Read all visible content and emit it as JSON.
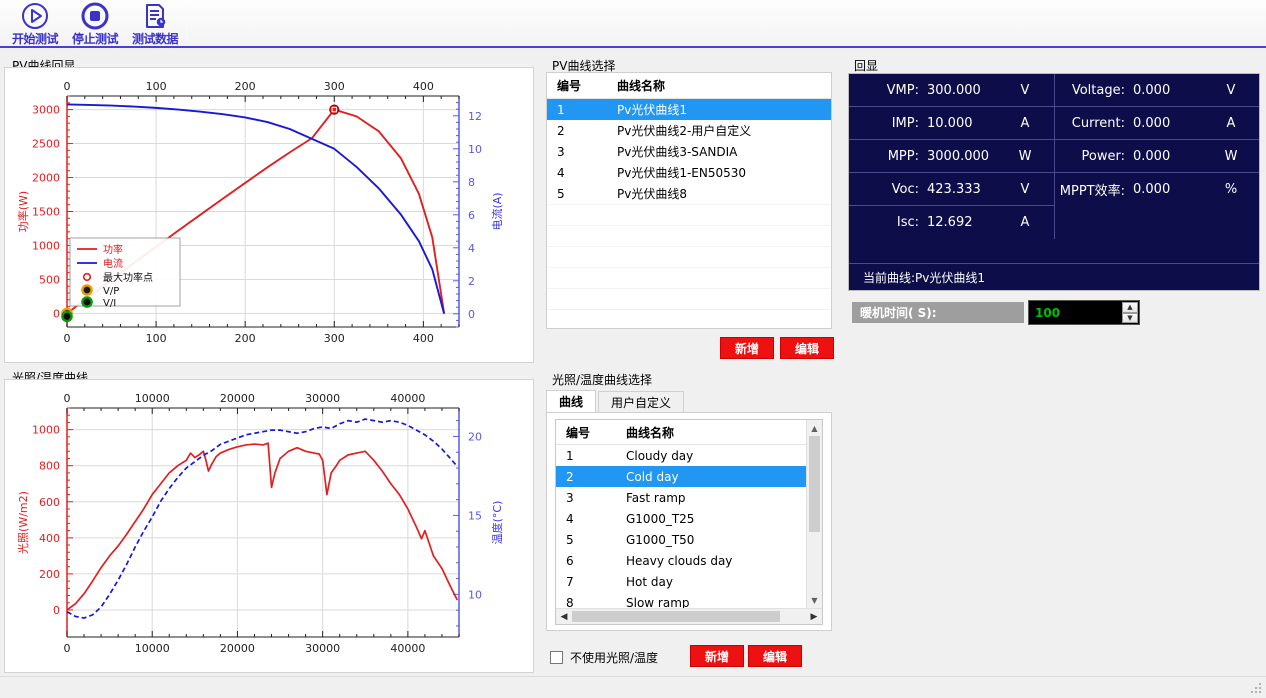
{
  "toolbar": {
    "buttons": [
      {
        "label": "开始测试",
        "icon": "play-circle-icon"
      },
      {
        "label": "停止测试",
        "icon": "stop-circle-icon"
      },
      {
        "label": "测试数据",
        "icon": "document-clock-icon"
      }
    ]
  },
  "pv_chart_group": {
    "title": "PV曲线回显"
  },
  "irr_chart_group": {
    "title": "光照/温度曲线"
  },
  "pv_select": {
    "title": "PV曲线选择",
    "columns": [
      "编号",
      "曲线名称"
    ],
    "rows": [
      {
        "id": "1",
        "name": "Pv光伏曲线1",
        "selected": true
      },
      {
        "id": "2",
        "name": "Pv光伏曲线2-用户自定义",
        "selected": false
      },
      {
        "id": "3",
        "name": "Pv光伏曲线3-SANDIA",
        "selected": false
      },
      {
        "id": "4",
        "name": "Pv光伏曲线1-EN50530",
        "selected": false
      },
      {
        "id": "5",
        "name": "Pv光伏曲线8",
        "selected": false
      }
    ],
    "add_label": "新增",
    "edit_label": "编辑"
  },
  "irr_select": {
    "title": "光照/温度曲线选择",
    "tabs": [
      {
        "label": "曲线",
        "active": true
      },
      {
        "label": "用户自定义",
        "active": false
      }
    ],
    "columns": [
      "编号",
      "曲线名称"
    ],
    "rows": [
      {
        "id": "1",
        "name": "Cloudy day",
        "selected": false
      },
      {
        "id": "2",
        "name": "Cold day",
        "selected": true
      },
      {
        "id": "3",
        "name": "Fast ramp",
        "selected": false
      },
      {
        "id": "4",
        "name": "G1000_T25",
        "selected": false
      },
      {
        "id": "5",
        "name": "G1000_T50",
        "selected": false
      },
      {
        "id": "6",
        "name": "Heavy clouds day",
        "selected": false
      },
      {
        "id": "7",
        "name": "Hot day",
        "selected": false
      },
      {
        "id": "8",
        "name": "Slow ramp",
        "selected": false
      }
    ],
    "checkbox_label": "不使用光照/温度",
    "checkbox_checked": false,
    "add_label": "新增",
    "edit_label": "编辑"
  },
  "readout": {
    "title": "回显",
    "left": [
      {
        "key": "VMP:",
        "value": "300.000",
        "unit": "V"
      },
      {
        "key": "IMP:",
        "value": "10.000",
        "unit": "A"
      },
      {
        "key": "MPP:",
        "value": "3000.000",
        "unit": "W"
      },
      {
        "key": "Voc:",
        "value": "423.333",
        "unit": "V"
      },
      {
        "key": "Isc:",
        "value": "12.692",
        "unit": "A"
      }
    ],
    "right": [
      {
        "key": "Voltage:",
        "value": "0.000",
        "unit": "V"
      },
      {
        "key": "Current:",
        "value": "0.000",
        "unit": "A"
      },
      {
        "key": "Power:",
        "value": "0.000",
        "unit": "W"
      },
      {
        "key": "MPPT效率:",
        "value": "0.000",
        "unit": "%"
      }
    ],
    "footer": "当前曲线:Pv光伏曲线1",
    "bg_color": "#0d0d4a"
  },
  "warmup": {
    "label": "暖机时间( S):",
    "value": "100"
  },
  "colors": {
    "accent_blue": "#4a3fd0",
    "power_red": "#e02020",
    "current_blue": "#1818d8",
    "select_blue": "#2196f3",
    "button_red": "#ee1111"
  },
  "chart_data": [
    {
      "type": "line",
      "title": "PV曲线回显",
      "xlabel": "",
      "ylabel": "功率(W)",
      "y2label": "电流(A)",
      "xlim": [
        0,
        440
      ],
      "ylim": [
        -200,
        3200
      ],
      "y2lim": [
        -0.8,
        13.2
      ],
      "xticks": [
        0,
        100,
        200,
        300,
        400
      ],
      "yticks": [
        0,
        500,
        1000,
        1500,
        2000,
        2500,
        3000
      ],
      "y2ticks": [
        0,
        2,
        4,
        6,
        8,
        10,
        12
      ],
      "grid": true,
      "legend_position": "lower-left",
      "legend": [
        "功率",
        "电流",
        "最大功率点",
        "V/P",
        "V/I"
      ],
      "annotations": [
        {
          "label": "最大功率点",
          "x": 300,
          "y": 3000
        }
      ],
      "series": [
        {
          "name": "功率",
          "color": "#e02020",
          "axis": "left",
          "x": [
            0,
            25,
            50,
            75,
            100,
            125,
            150,
            175,
            200,
            225,
            250,
            275,
            300,
            325,
            350,
            375,
            395,
            410,
            423.3
          ],
          "y": [
            0,
            248,
            495,
            740,
            980,
            1220,
            1455,
            1690,
            1920,
            2150,
            2370,
            2580,
            3000,
            2900,
            2680,
            2280,
            1760,
            1120,
            0
          ]
        },
        {
          "name": "电流",
          "color": "#1818d8",
          "axis": "right",
          "x": [
            0,
            25,
            50,
            75,
            100,
            125,
            150,
            175,
            200,
            225,
            250,
            275,
            300,
            325,
            350,
            375,
            395,
            410,
            423.3
          ],
          "y": [
            12.69,
            12.66,
            12.62,
            12.56,
            12.48,
            12.38,
            12.25,
            12.1,
            11.9,
            11.62,
            11.2,
            10.6,
            10.0,
            8.9,
            7.6,
            6.0,
            4.4,
            2.7,
            0
          ]
        }
      ]
    },
    {
      "type": "line",
      "title": "光照/温度曲线",
      "xlabel": "",
      "ylabel": "光照(W/m2)",
      "y2label": "温度(°C)",
      "xlim": [
        0,
        46000
      ],
      "ylim": [
        -150,
        1120
      ],
      "y2lim": [
        7.3,
        21.8
      ],
      "xticks": [
        0,
        10000,
        20000,
        30000,
        40000
      ],
      "yticks": [
        0,
        200,
        400,
        600,
        800,
        1000
      ],
      "y2ticks": [
        10,
        15,
        20
      ],
      "grid": true,
      "series": [
        {
          "name": "光照",
          "color": "#e02020",
          "axis": "left",
          "x": [
            0,
            1000,
            2000,
            3000,
            4000,
            5000,
            6000,
            7000,
            8000,
            9000,
            10000,
            11000,
            12000,
            13000,
            14000,
            14500,
            15000,
            15500,
            16000,
            16300,
            16600,
            17000,
            17500,
            18000,
            19000,
            20000,
            21000,
            22000,
            23000,
            23600,
            24000,
            24400,
            25000,
            26000,
            27000,
            28000,
            29000,
            29600,
            30000,
            30500,
            31000,
            31600,
            32000,
            33000,
            34000,
            35000,
            36000,
            37000,
            38000,
            39000,
            40000,
            41000,
            41600,
            42000,
            43000,
            44000,
            45000,
            45800
          ],
          "y": [
            0,
            35,
            90,
            160,
            235,
            300,
            355,
            420,
            490,
            560,
            640,
            700,
            760,
            800,
            830,
            870,
            845,
            860,
            880,
            830,
            770,
            810,
            850,
            870,
            890,
            905,
            915,
            920,
            915,
            925,
            680,
            760,
            840,
            880,
            900,
            880,
            870,
            865,
            830,
            640,
            760,
            800,
            830,
            860,
            870,
            880,
            830,
            770,
            700,
            640,
            560,
            460,
            395,
            440,
            300,
            230,
            130,
            55
          ]
        },
        {
          "name": "温度",
          "color": "#1818d8",
          "axis": "right",
          "x": [
            0,
            1000,
            2000,
            3000,
            4000,
            5000,
            6000,
            7000,
            8000,
            9000,
            10000,
            11000,
            12000,
            13000,
            14000,
            15000,
            16000,
            17000,
            18000,
            19000,
            20000,
            21000,
            22000,
            23000,
            24000,
            25000,
            26000,
            27000,
            28000,
            29000,
            30000,
            31000,
            32000,
            33000,
            34000,
            35000,
            36000,
            37000,
            38000,
            39000,
            40000,
            41000,
            42000,
            43000,
            44000,
            45000,
            45800
          ],
          "y": [
            8.9,
            8.6,
            8.5,
            8.7,
            9.2,
            10.0,
            10.9,
            11.9,
            13.0,
            14.0,
            14.9,
            15.9,
            16.7,
            17.4,
            18.0,
            18.4,
            18.8,
            19.1,
            19.5,
            19.7,
            19.9,
            20.1,
            20.2,
            20.3,
            20.4,
            20.4,
            20.3,
            20.2,
            20.3,
            20.5,
            20.6,
            20.5,
            20.8,
            21.0,
            20.9,
            21.1,
            21.0,
            20.9,
            21.0,
            20.9,
            20.7,
            20.4,
            20.1,
            19.7,
            19.2,
            18.6,
            18.1
          ]
        }
      ]
    }
  ]
}
